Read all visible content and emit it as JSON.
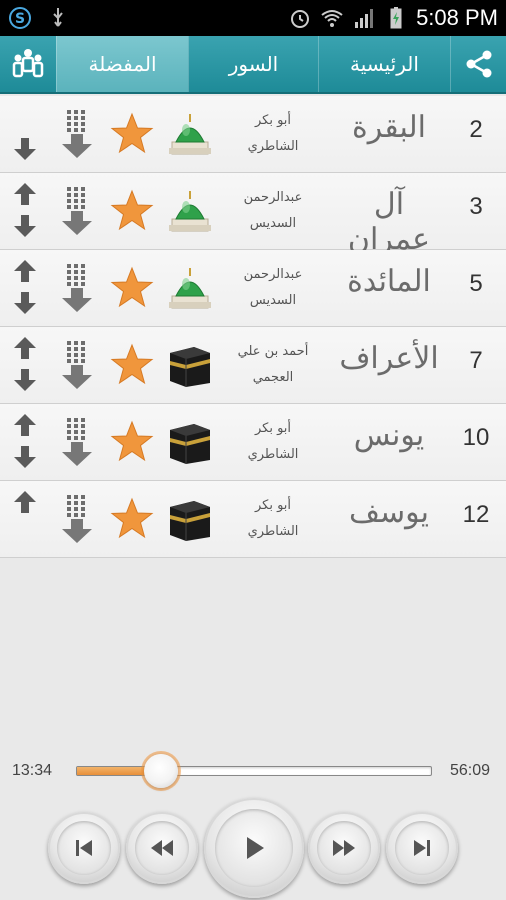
{
  "status_bar": {
    "time": "5:08 PM",
    "icons": [
      "skype-icon",
      "usb-icon",
      "alarm-icon",
      "wifi-icon",
      "signal-icon",
      "battery-charging-icon"
    ]
  },
  "tabs": {
    "home": "الرئيسية",
    "surahs": "السور",
    "favorites": "المفضلة",
    "active": "favorites"
  },
  "surahs": [
    {
      "number": "2",
      "name": "البقرة",
      "reciter_line1": "أبو بكر",
      "reciter_line2": "الشاطري",
      "place": "madinah",
      "show_up": false,
      "show_down": true
    },
    {
      "number": "3",
      "name": "آل عمران",
      "reciter_line1": "عبدالرحمن",
      "reciter_line2": "السديس",
      "place": "madinah",
      "show_up": true,
      "show_down": true
    },
    {
      "number": "5",
      "name": "المائدة",
      "reciter_line1": "عبدالرحمن",
      "reciter_line2": "السديس",
      "place": "madinah",
      "show_up": true,
      "show_down": true
    },
    {
      "number": "7",
      "name": "الأعراف",
      "reciter_line1": "أحمد بن علي",
      "reciter_line2": "العجمي",
      "place": "makkah",
      "show_up": true,
      "show_down": true
    },
    {
      "number": "10",
      "name": "يونس",
      "reciter_line1": "أبو بكر",
      "reciter_line2": "الشاطري",
      "place": "makkah",
      "show_up": true,
      "show_down": true
    },
    {
      "number": "12",
      "name": "يوسف",
      "reciter_line1": "أبو بكر",
      "reciter_line2": "الشاطري",
      "place": "makkah",
      "show_up": true,
      "show_down": false
    }
  ],
  "player": {
    "elapsed": "13:34",
    "total": "56:09",
    "progress_fraction": 0.24
  },
  "colors": {
    "accent": "#2596a3",
    "star": "#f0963c",
    "progress": "#e8903a"
  }
}
